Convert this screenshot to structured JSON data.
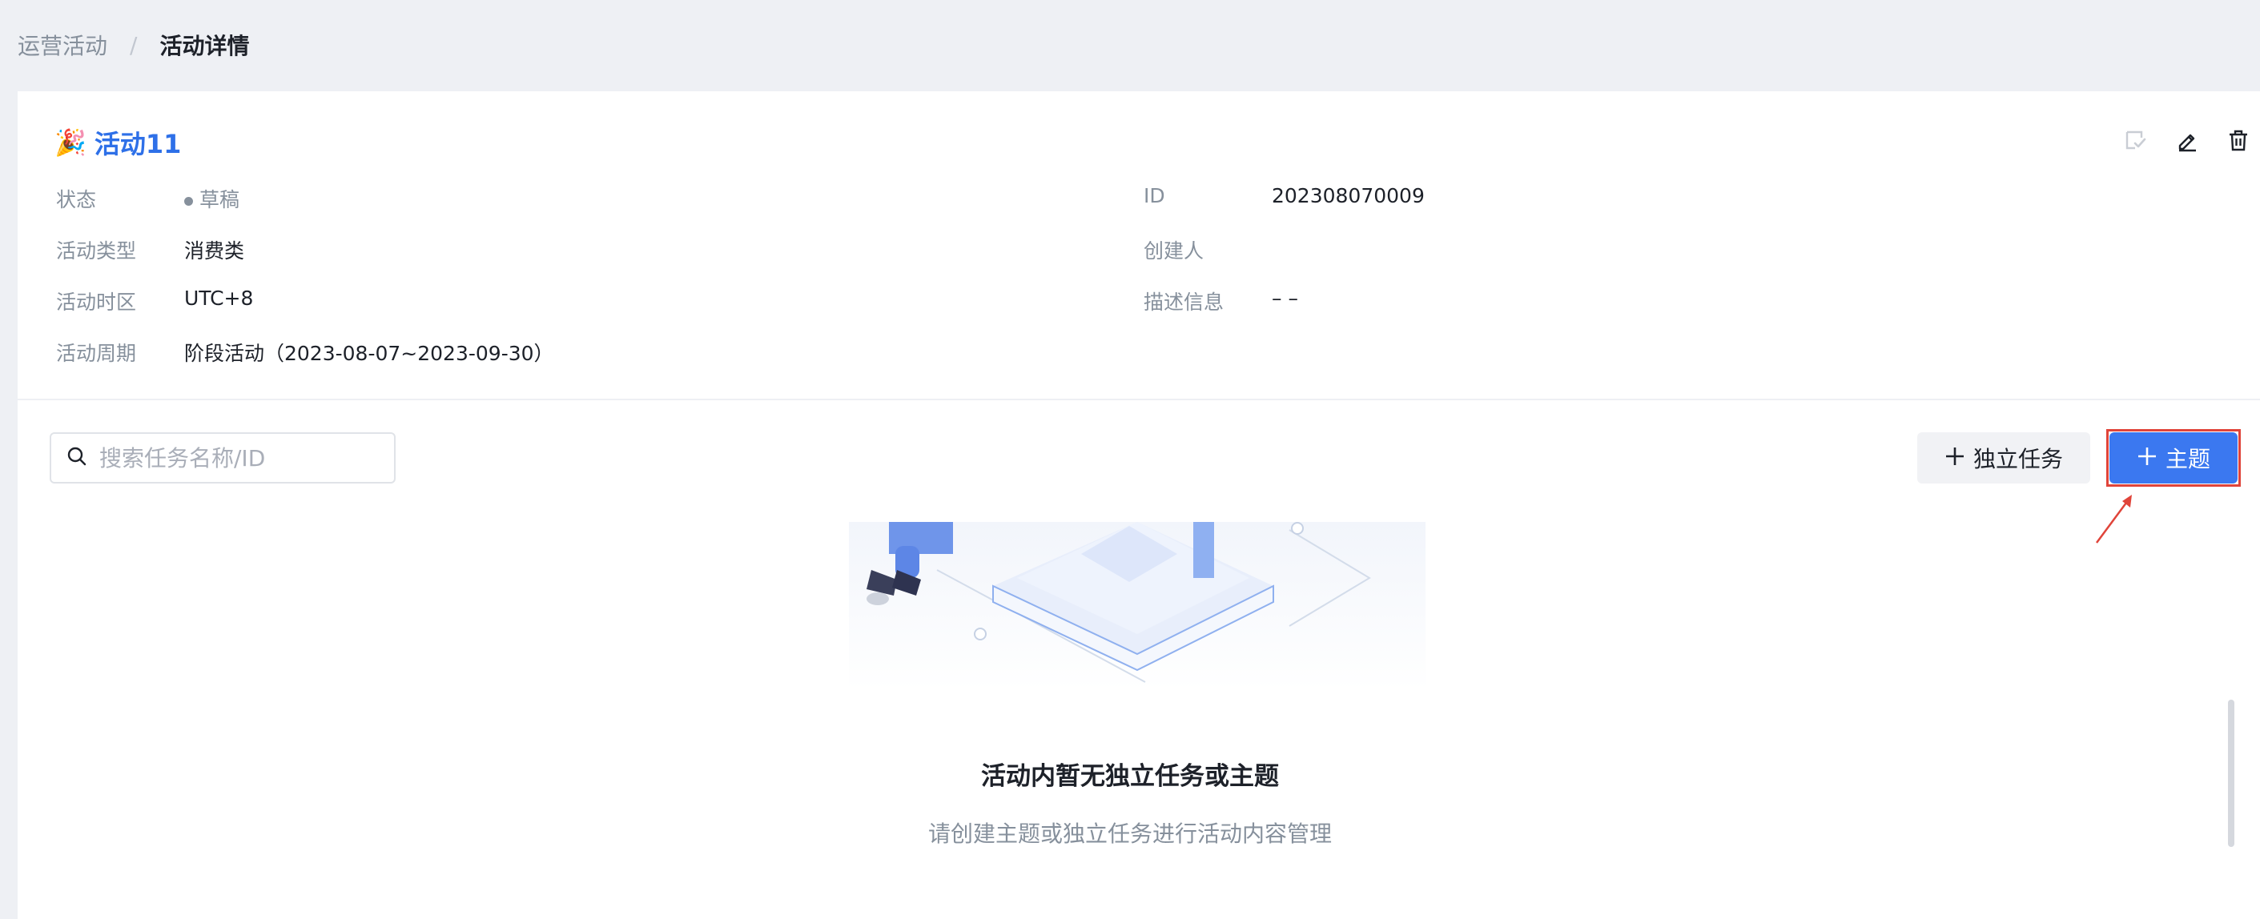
{
  "breadcrumb": {
    "parent": "运营活动",
    "separator": "/",
    "current": "活动详情"
  },
  "activity": {
    "emoji": "🎉",
    "title": "活动11",
    "left_fields": [
      {
        "label": "状态",
        "value": "草稿"
      },
      {
        "label": "活动类型",
        "value": "消费类"
      },
      {
        "label": "活动时区",
        "value": "UTC+8"
      },
      {
        "label": "活动周期",
        "value": "阶段活动（2023-08-07~2023-09-30）"
      }
    ],
    "right_fields": [
      {
        "label": "ID",
        "value": "202308070009"
      },
      {
        "label": "创建人",
        "value": ""
      },
      {
        "label": "描述信息",
        "value": "– –"
      }
    ]
  },
  "toolbar": {
    "search_placeholder": "搜索任务名称/ID",
    "independent_task_label": "独立任务",
    "theme_label": "主题"
  },
  "empty_state": {
    "title": "活动内暂无独立任务或主题",
    "description": "请创建主题或独立任务进行活动内容管理"
  },
  "icons": [
    "checkmark-icon",
    "edit-icon",
    "delete-icon",
    "search-icon",
    "plus-icon",
    "arrow-icon"
  ],
  "colors": {
    "accent": "#3b78f0",
    "title": "#2e70e8",
    "highlight": "#e0443a",
    "muted": "#86909c"
  }
}
